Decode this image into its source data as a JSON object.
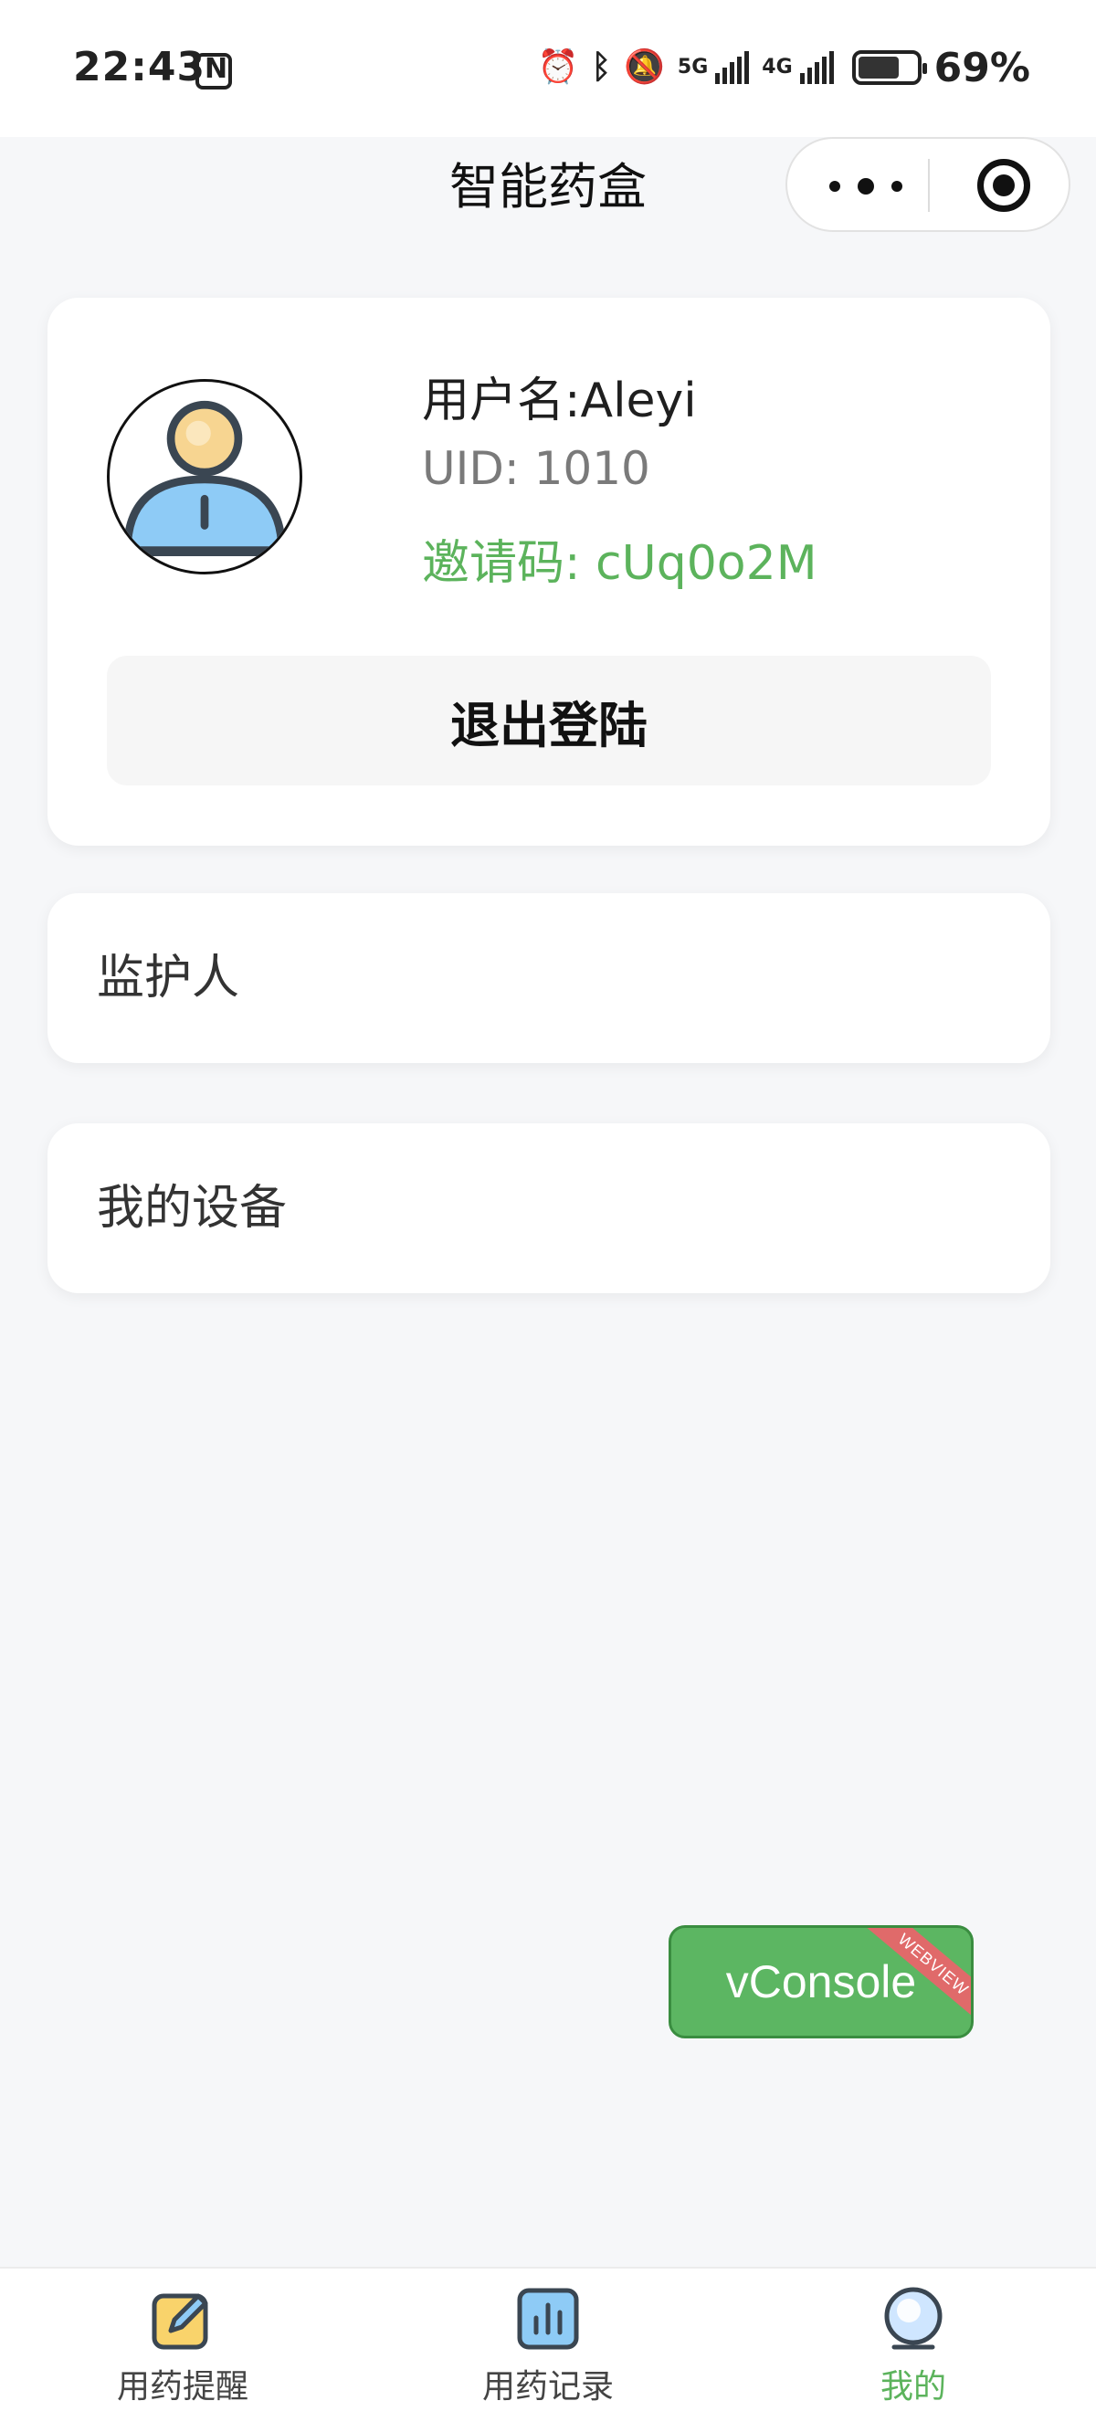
{
  "status_bar": {
    "time": "22:43",
    "network_5g": "5G",
    "network_4g": "4G",
    "battery_percent": "69%",
    "battery_level": 0.69,
    "icons": [
      "nfc-icon",
      "alarm-icon",
      "bluetooth-icon",
      "mute-icon",
      "signal-icon",
      "battery-icon"
    ]
  },
  "nav": {
    "title": "智能药盒"
  },
  "profile": {
    "username": "用户名:Aleyi",
    "uid": "UID: 1010",
    "invite_code": "邀请码: cUq0o2M",
    "logout_label": "退出登陆"
  },
  "menu": {
    "guardian_label": "监护人",
    "device_label": "我的设备"
  },
  "vconsole": {
    "label": "vConsole",
    "badge": "WEBVIEW"
  },
  "tabbar": {
    "items": [
      {
        "label": "用药提醒",
        "icon": "edit-note-icon",
        "active": false
      },
      {
        "label": "用药记录",
        "icon": "bar-chart-icon",
        "active": false
      },
      {
        "label": "我的",
        "icon": "profile-orb-icon",
        "active": true
      }
    ]
  },
  "colors": {
    "accent_green": "#5cb35c",
    "page_background": "#f6f7f9",
    "card_background": "#ffffff",
    "vconsole_green": "#5cb662",
    "ribbon_red": "#e06a6a"
  }
}
